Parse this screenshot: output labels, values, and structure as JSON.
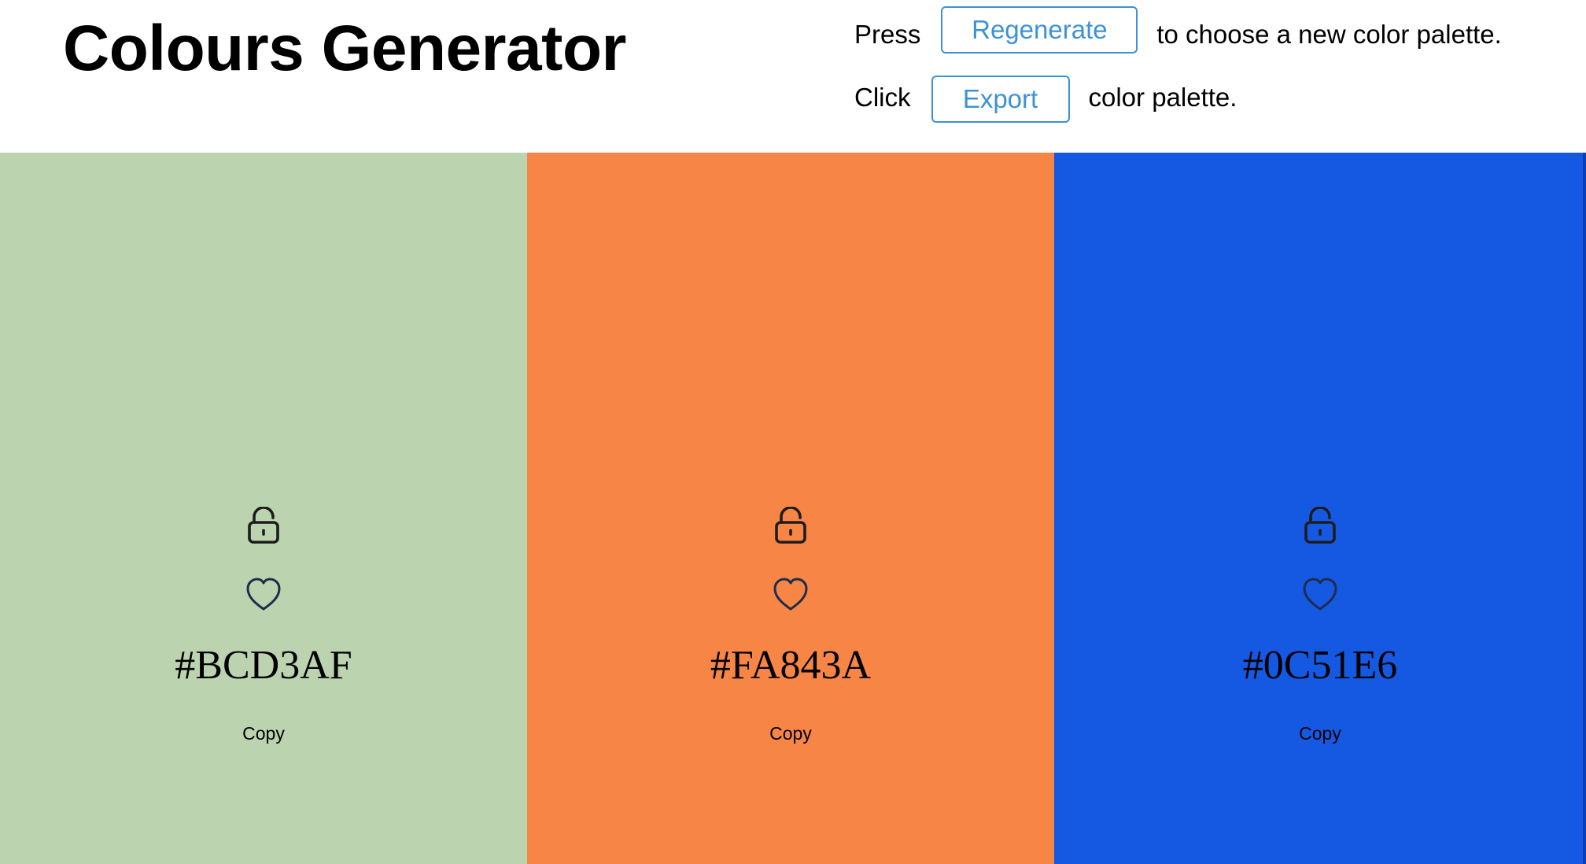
{
  "header": {
    "title": "Colours Generator",
    "line1_prefix": "Press",
    "regenerate_label": "Regenerate",
    "line1_suffix": "to choose a new color palette.",
    "line2_prefix": "Click",
    "export_label": "Export",
    "line2_suffix": "color palette."
  },
  "colors": {
    "button_accent": "#3d92d6"
  },
  "palette": [
    {
      "hex": "#BCD3AF",
      "background": "#bcd3af",
      "lock_icon": "unlocked-padlock-icon",
      "heart_icon": "heart-outline-icon",
      "copy_label": "Copy"
    },
    {
      "hex": "#FA843A",
      "background": "#f78545",
      "lock_icon": "unlocked-padlock-icon",
      "heart_icon": "heart-outline-icon",
      "copy_label": "Copy"
    },
    {
      "hex": "#0C51E6",
      "background": "#1559e3",
      "lock_icon": "unlocked-padlock-icon",
      "heart_icon": "heart-outline-icon",
      "copy_label": "Copy"
    }
  ]
}
